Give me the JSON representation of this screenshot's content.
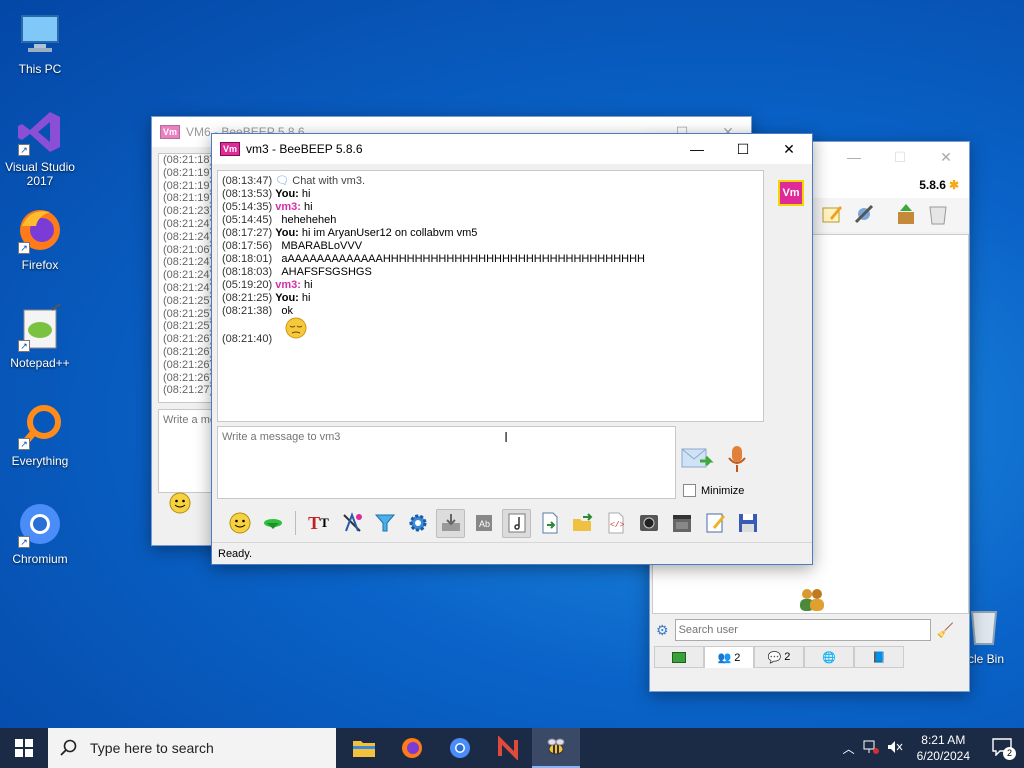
{
  "desktop_icons": [
    {
      "label": "This PC"
    },
    {
      "label": "Visual Studio 2017"
    },
    {
      "label": "Firefox"
    },
    {
      "label": "Notepad++"
    },
    {
      "label": "Everything"
    },
    {
      "label": "Chromium"
    },
    {
      "label": "rcle Bin"
    }
  ],
  "vm6_window": {
    "title": "VM6 - BeeBEEP 5.8.6",
    "times": [
      "(08:21:18)",
      "(08:21:19)",
      "(08:21:19)",
      "(08:21:19)",
      "(08:21:23)",
      "(08:21:24)",
      "(08:21:24)",
      "(08:21:06)",
      "(08:21:24)",
      "(08:21:24)",
      "(08:21:24)",
      "(08:21:25)",
      "(08:21:25)",
      "(08:21:25)",
      "(08:21:26)",
      "(08:21:26)",
      "(08:21:26)",
      "(08:21:26)",
      "(08:21:27)"
    ],
    "write_placeholder": "Write a me"
  },
  "main_window": {
    "version": "5.8.6",
    "search_placeholder": "Search user",
    "tab_users_count": "2",
    "tab_groups_count": "2"
  },
  "chat_window": {
    "title": "vm3 - BeeBEEP 5.8.6",
    "avatar_label": "Vm",
    "messages": [
      {
        "ts": "(08:13:47)",
        "kind": "sys",
        "text": "Chat with vm3."
      },
      {
        "ts": "(08:13:53)",
        "kind": "you",
        "sender": "You:",
        "text": " hi"
      },
      {
        "ts": "(05:14:35)",
        "kind": "vm3",
        "sender": "vm3:",
        "text": " hi"
      },
      {
        "ts": "(05:14:45)",
        "kind": "cont",
        "text": "heheheheh"
      },
      {
        "ts": "(08:17:27)",
        "kind": "you",
        "sender": "You:",
        "text": " hi im AryanUser12 on collabvm vm5"
      },
      {
        "ts": "(08:17:56)",
        "kind": "cont",
        "text": "MBARABLoVVV"
      },
      {
        "ts": "(08:18:01)",
        "kind": "cont",
        "text": "aAAAAAAAAAAAAAHHHHHHHHHHHHHHHHHHHHHHHHHHHHHHHHH"
      },
      {
        "ts": "(08:18:03)",
        "kind": "cont",
        "text": "AHAFSFSGSHGS"
      },
      {
        "ts": "(05:19:20)",
        "kind": "vm3",
        "sender": "vm3:",
        "text": " hi"
      },
      {
        "ts": "(08:21:25)",
        "kind": "you",
        "sender": "You:",
        "text": " hi"
      },
      {
        "ts": "(08:21:38)",
        "kind": "cont",
        "text": "ok"
      },
      {
        "ts": "(08:21:40)",
        "kind": "emoji",
        "text": ""
      }
    ],
    "compose_placeholder": "Write a message to vm3",
    "minimize_label": "Minimize",
    "status": "Ready."
  },
  "taskbar": {
    "search_placeholder": "Type here to search",
    "time": "8:21 AM",
    "date": "6/20/2024",
    "notifications": "2"
  },
  "colors": {
    "vm_badge": "#e02a9a",
    "vm3_name": "#d62ea8",
    "taskbar": "#1b2b46"
  }
}
